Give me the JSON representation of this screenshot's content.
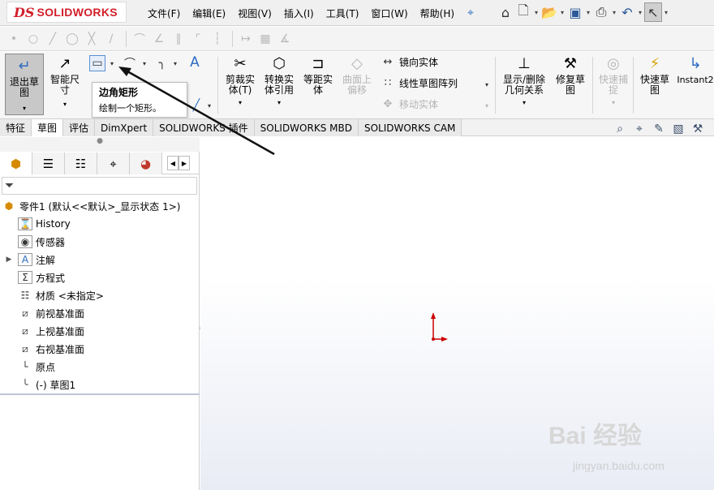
{
  "app": {
    "logo_mark": "DS",
    "logo_text": "SOLIDWORKS"
  },
  "menu": [
    "文件(F)",
    "编辑(E)",
    "视图(V)",
    "插入(I)",
    "工具(T)",
    "窗口(W)",
    "帮助(H)"
  ],
  "quick_access": [
    "home-icon",
    "new-document-icon",
    "open-icon",
    "save-icon",
    "print-icon",
    "undo-icon",
    "select-pointer-icon"
  ],
  "command_manager": {
    "exit_sketch": "退出草图",
    "smart_dimension": "智能尺寸",
    "trim_entities": "剪裁实体(T)",
    "convert_entities": "转换实体引用",
    "offset_entities": "等距实体",
    "offset_on_surface": "曲面上偏移",
    "mirror_entities": "镜向实体",
    "linear_pattern": "线性草图阵列",
    "move_entities": "移动实体",
    "display_delete_relations": "显示/删除几何关系",
    "repair_sketch": "修复草图",
    "quick_snaps": "快速捕捉",
    "rapid_sketch": "快速草图",
    "instant2d": "Instant2"
  },
  "tooltip": {
    "title": "边角矩形",
    "description": "绘制一个矩形。"
  },
  "tabs": [
    "特征",
    "草图",
    "评估",
    "DimXpert",
    "SOLIDWORKS 插件",
    "SOLIDWORKS MBD",
    "SOLIDWORKS CAM"
  ],
  "active_tab": "草图",
  "feature_tree": {
    "root": "零件1  (默认<<默认>_显示状态 1>)",
    "items": [
      {
        "label": "History",
        "icon": "history-icon"
      },
      {
        "label": "传感器",
        "icon": "sensor-icon"
      },
      {
        "label": "注解",
        "icon": "annotation-icon",
        "expandable": true
      },
      {
        "label": "方程式",
        "icon": "equation-icon"
      },
      {
        "label": "材质 <未指定>",
        "icon": "material-icon"
      },
      {
        "label": "前视基准面",
        "icon": "plane-icon"
      },
      {
        "label": "上视基准面",
        "icon": "plane-icon"
      },
      {
        "label": "右视基准面",
        "icon": "plane-icon"
      },
      {
        "label": "原点",
        "icon": "origin-icon"
      },
      {
        "label": "(-) 草图1",
        "icon": "sketch-icon"
      }
    ]
  },
  "watermark": {
    "brand": "Bai 经验",
    "url": "jingyan.baidu.com"
  },
  "colors": {
    "brand_red": "#d21f2a",
    "origin_red": "#cc0000",
    "graphics_gradient_bottom": "#e9ecf5"
  }
}
